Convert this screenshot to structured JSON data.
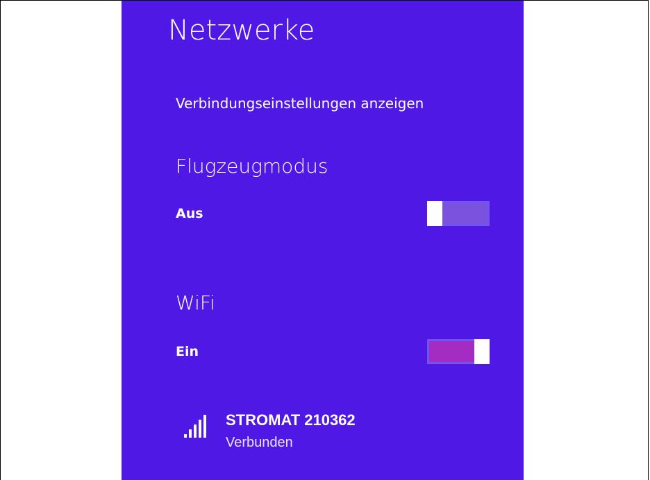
{
  "panel": {
    "title": "Netzwerke",
    "settings_link": "Verbindungseinstellungen anzeigen",
    "background_color": "#5018e4"
  },
  "airplane_mode": {
    "heading": "Flugzeugmodus",
    "state_label": "Aus",
    "enabled": false,
    "track_color": "#7a52de"
  },
  "wifi": {
    "heading": "WiFi",
    "state_label": "Ein",
    "enabled": true,
    "track_color": "#a42cc2"
  },
  "networks": [
    {
      "name": "STROMAT 210362",
      "status": "Verbunden",
      "icon": "wifi-signal-icon",
      "signal_bars": 5
    }
  ]
}
